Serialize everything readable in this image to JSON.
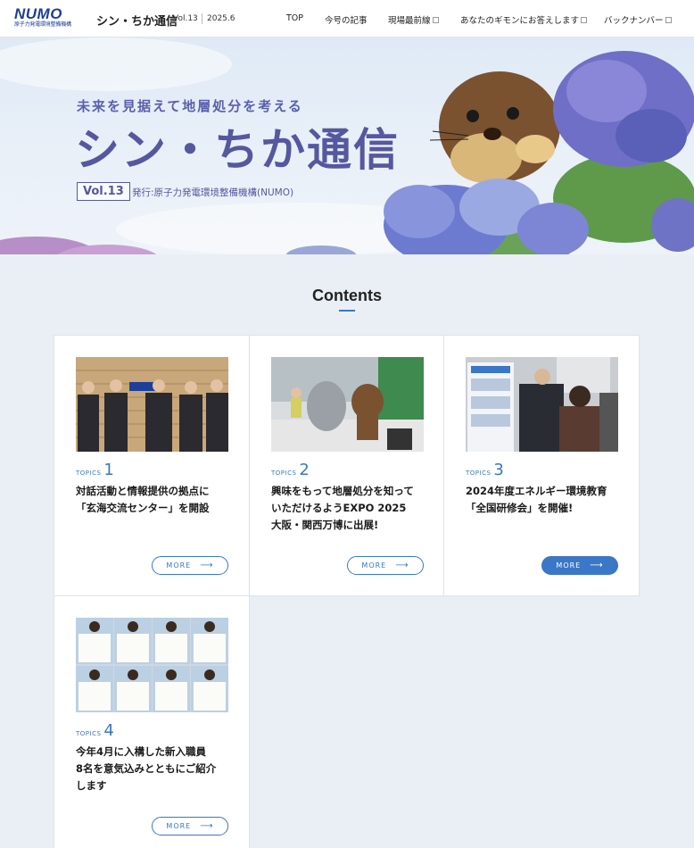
{
  "header": {
    "logo_main": "NUMO",
    "logo_sub": "原子力発電環境整備機構",
    "site_title": "シン・ちか通信",
    "vol": "Vol.13",
    "date": "2025.6",
    "nav": [
      {
        "label": "TOP",
        "external": false
      },
      {
        "label": "今号の記事",
        "external": false
      },
      {
        "label": "現場最前線",
        "external": true
      },
      {
        "label": "あなたのギモンにお答えします",
        "external": true
      },
      {
        "label": "バックナンバー",
        "external": true
      }
    ]
  },
  "hero": {
    "subtitle": "未来を見据えて地層処分を考える",
    "title": "シン・ちか通信",
    "vol": "Vol.13",
    "publisher": "発行:原子力発電環境整備機構(NUMO)"
  },
  "contents": {
    "title": "Contents",
    "topic_label": "TOPICS",
    "more_label": "MORE",
    "cards": [
      {
        "num": "1",
        "lines": [
          "対話活動と情報提供の拠点に",
          "「玄海交流センター」を開設"
        ],
        "active": false
      },
      {
        "num": "2",
        "lines": [
          "興味をもって地層処分を知って",
          "いただけるようEXPO 2025",
          "大阪・関西万博に出展!"
        ],
        "active": false
      },
      {
        "num": "3",
        "lines": [
          "2024年度エネルギー環境教育",
          "「全国研修会」を開催!"
        ],
        "active": true
      },
      {
        "num": "4",
        "lines": [
          "今年4月に入構した新入職員",
          "8名を意気込みとともにご紹介",
          "します"
        ],
        "active": false
      }
    ]
  },
  "colors": {
    "accent": "#3a77c6",
    "hero_title": "#55589f",
    "logo": "#1d3f97"
  }
}
